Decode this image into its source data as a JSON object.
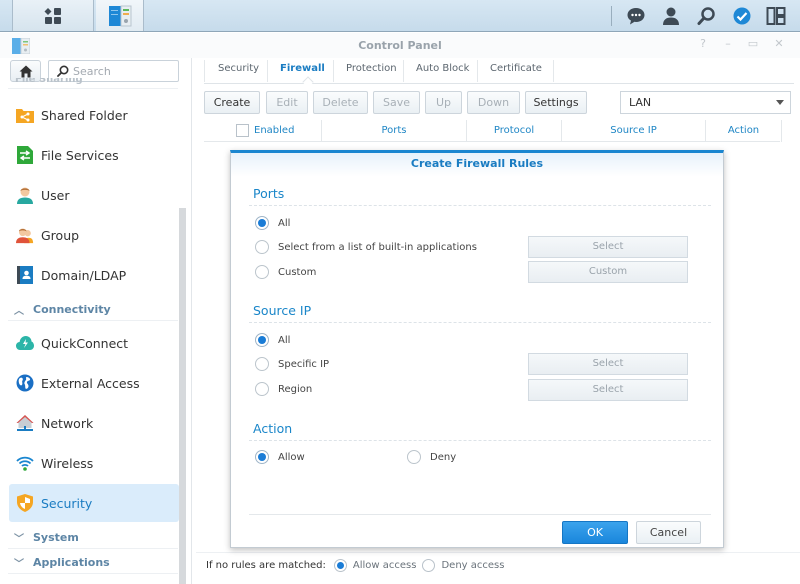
{
  "taskbar": {
    "items": [
      {
        "name": "main-menu",
        "icon": "grid-icon"
      },
      {
        "name": "control-panel",
        "icon": "control-panel-icon"
      }
    ],
    "right_icons": [
      "chat-icon",
      "user-icon",
      "search-icon",
      "dashboard-icon",
      "widgets-icon"
    ]
  },
  "window": {
    "title": "Control Panel",
    "controls": {
      "help": "?",
      "minimize": "–",
      "maximize": "▭",
      "close": "✕"
    }
  },
  "sidebar": {
    "search_placeholder": "Search",
    "cut_header": "File Sharing",
    "items": [
      {
        "label": "Shared Folder",
        "icon": "shared-folder-icon",
        "color": "#f5a623"
      },
      {
        "label": "File Services",
        "icon": "file-services-icon",
        "color": "#2fa83a"
      },
      {
        "label": "User",
        "icon": "user-icon",
        "color": "#27a8a0"
      },
      {
        "label": "Group",
        "icon": "group-icon",
        "color": "#e0533a"
      },
      {
        "label": "Domain/LDAP",
        "icon": "domain-ldap-icon",
        "color": "#1a7cc2"
      }
    ],
    "groups": {
      "connectivity": {
        "label": "Connectivity",
        "expanded": true
      },
      "system": {
        "label": "System",
        "expanded": false
      },
      "applications": {
        "label": "Applications",
        "expanded": false
      }
    },
    "connectivity_items": [
      {
        "label": "QuickConnect",
        "icon": "quickconnect-icon",
        "color": "#2cb5a8"
      },
      {
        "label": "External Access",
        "icon": "external-access-icon",
        "color": "#1a6fc4"
      },
      {
        "label": "Network",
        "icon": "network-icon",
        "color": "#d9534f"
      },
      {
        "label": "Wireless",
        "icon": "wireless-icon",
        "color": "#1a86d0"
      },
      {
        "label": "Security",
        "icon": "security-icon",
        "color": "#f5a623",
        "active": true
      }
    ]
  },
  "main": {
    "tabs": [
      {
        "label": "Security",
        "active": false
      },
      {
        "label": "Firewall",
        "active": true
      },
      {
        "label": "Protection",
        "active": false
      },
      {
        "label": "Auto Block",
        "active": false
      },
      {
        "label": "Certificate",
        "active": false
      }
    ],
    "toolbar": {
      "create": "Create",
      "edit": "Edit",
      "delete": "Delete",
      "save": "Save",
      "up": "Up",
      "down": "Down",
      "settings": "Settings"
    },
    "interface_select": "LAN",
    "columns": [
      "Enabled",
      "Ports",
      "Protocol",
      "Source IP",
      "Action"
    ],
    "footer": {
      "label": "If no rules are matched:",
      "allow": "Allow access",
      "deny": "Deny access",
      "selected": "allow"
    }
  },
  "modal": {
    "title": "Create Firewall Rules",
    "ports": {
      "title": "Ports",
      "options": [
        "All",
        "Select from a list of built-in applications",
        "Custom"
      ],
      "selected": 0,
      "select_button": "Select",
      "custom_button": "Custom"
    },
    "source_ip": {
      "title": "Source IP",
      "options": [
        "All",
        "Specific IP",
        "Region"
      ],
      "selected": 0,
      "specific_button": "Select",
      "region_button": "Select"
    },
    "action": {
      "title": "Action",
      "options": [
        "Allow",
        "Deny"
      ],
      "selected": 0
    },
    "ok": "OK",
    "cancel": "Cancel"
  },
  "colors": {
    "accent": "#1a86d0",
    "active_bg": "#daecfb",
    "section_blue": "#1a86c9"
  }
}
